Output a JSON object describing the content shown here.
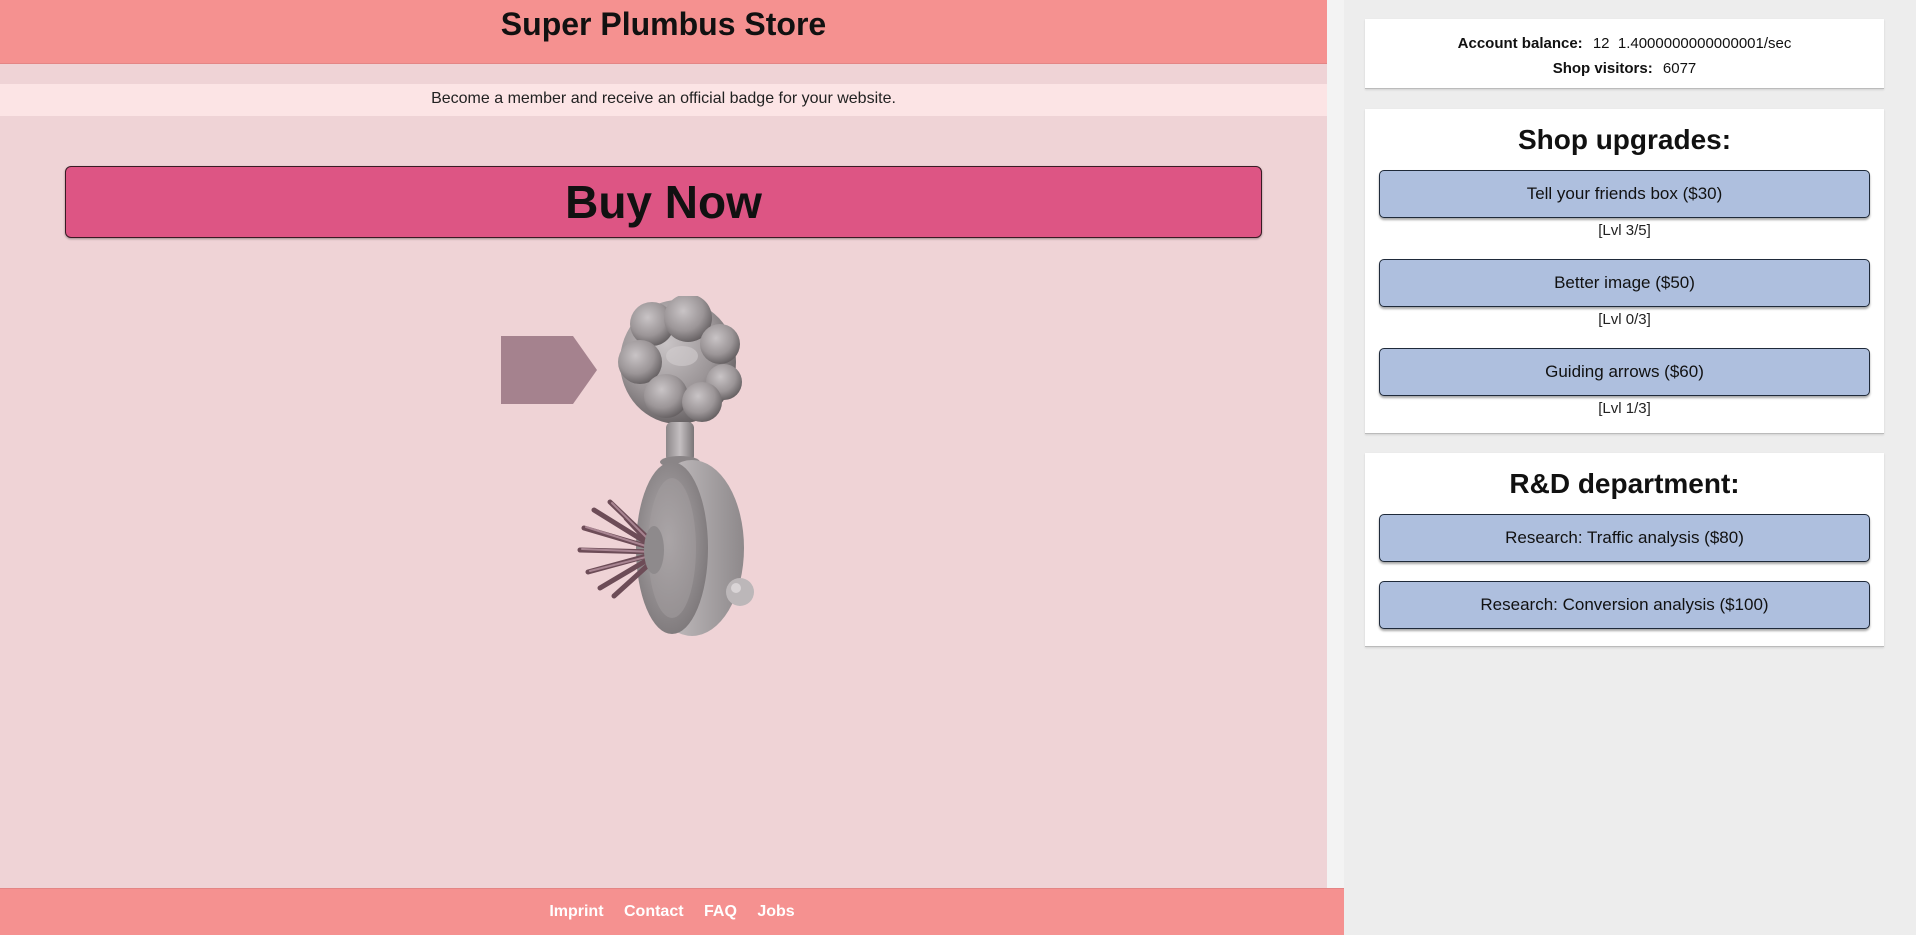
{
  "store": {
    "title": "Super Plumbus Store",
    "member_banner": "Become a member and receive an official badge for your website.",
    "buy_now_label": "Buy Now",
    "footer_links": [
      "Imprint",
      "Contact",
      "FAQ",
      "Jobs"
    ]
  },
  "stats": {
    "balance_label": "Account balance:",
    "balance_value": "12  1.4000000000000001/sec",
    "visitors_label": "Shop visitors:",
    "visitors_value": "6077"
  },
  "upgrades": {
    "title": "Shop upgrades:",
    "items": [
      {
        "label": "Tell your friends box ($30)",
        "level": "[Lvl 3/5]"
      },
      {
        "label": "Better image ($50)",
        "level": "[Lvl 0/3]"
      },
      {
        "label": "Guiding arrows ($60)",
        "level": "[Lvl 1/3]"
      }
    ]
  },
  "rd": {
    "title": "R&D department:",
    "items": [
      {
        "label": "Research: Traffic analysis ($80)"
      },
      {
        "label": "Research: Conversion analysis ($100)"
      }
    ]
  },
  "colors": {
    "header_bg": "#f59190",
    "page_bg": "#efd3d6",
    "buy_button": "#dd5584",
    "upgrade_button": "#aebfde",
    "sidebar_bg": "#ededed"
  },
  "icons": {
    "guide_arrow": "right-pointing-arrow",
    "product_image": "plumbus"
  }
}
